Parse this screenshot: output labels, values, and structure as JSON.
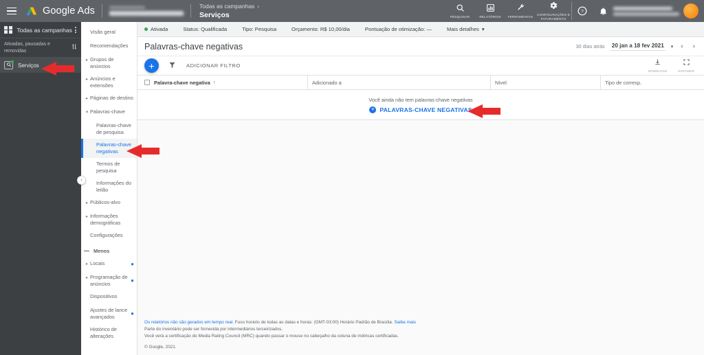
{
  "colors": {
    "accent_blue": "#1a73e8",
    "topbar_gray": "#5f6368",
    "sidebar_dark": "#3c4043",
    "status_green": "#34a853",
    "annotation_red": "#e62c2b"
  },
  "topbar": {
    "menu_icon": "hamburger-icon",
    "product_name": "Google Ads",
    "breadcrumb_parent": "Todas as campanhas",
    "breadcrumb_current": "Serviços",
    "tools": [
      {
        "icon": "search-icon",
        "glyph": "⌕",
        "label": "Pesquisar"
      },
      {
        "icon": "reports-bar-chart-icon",
        "glyph": "ὌA",
        "label": "Relatórios"
      },
      {
        "icon": "wrench-tools-icon",
        "glyph": "ὒ7",
        "label": "Ferramentas"
      },
      {
        "icon": "gear-settings-icon",
        "glyph": "⚙",
        "label": "Configurações e faturamento"
      }
    ],
    "help_icon": "help-circle-icon",
    "notifications_icon": "bell-icon",
    "avatar": "user-avatar"
  },
  "campaign_sidebar": {
    "header": "Todas as campanhas",
    "header_icon": "grid-apps-icon",
    "overflow_icon": "kebab-menu-icon",
    "filter_label": "Ativadas, pausadas e removidas",
    "sort_icon": "sort-arrows-icon",
    "campaign": {
      "name": "Serviços",
      "icon": "search-campaign-icon",
      "status": "enabled"
    }
  },
  "nav_panel": {
    "items": [
      {
        "label": "Visão geral",
        "expandable": false,
        "sub": false,
        "selected": false,
        "dot": false
      },
      {
        "label": "Recomendações",
        "expandable": false,
        "sub": false,
        "selected": false,
        "dot": false
      },
      {
        "label": "Grupos de anúncios",
        "expandable": true,
        "sub": false,
        "selected": false,
        "dot": false
      },
      {
        "label": "Anúncios e extensões",
        "expandable": true,
        "sub": false,
        "selected": false,
        "dot": false
      },
      {
        "label": "Páginas de destino",
        "expandable": true,
        "sub": false,
        "selected": false,
        "dot": false
      },
      {
        "label": "Palavras-chave",
        "expandable": true,
        "expanded": true,
        "sub": false,
        "selected": false,
        "dot": false
      },
      {
        "label": "Palavras-chave de pesquisa",
        "expandable": false,
        "sub": true,
        "selected": false,
        "dot": false
      },
      {
        "label": "Palavras-chave negativas",
        "expandable": false,
        "sub": true,
        "selected": true,
        "dot": false
      },
      {
        "label": "Termos de pesquisa",
        "expandable": false,
        "sub": true,
        "selected": false,
        "dot": false
      },
      {
        "label": "Informações do leilão",
        "expandable": false,
        "sub": true,
        "selected": false,
        "dot": false
      },
      {
        "label": "Públicos-alvo",
        "expandable": true,
        "sub": false,
        "selected": false,
        "dot": false
      },
      {
        "label": "Informações demográficas",
        "expandable": true,
        "sub": false,
        "selected": false,
        "dot": false
      },
      {
        "label": "Configurações",
        "expandable": false,
        "sub": false,
        "selected": false,
        "dot": false
      }
    ],
    "less_label": "Menos",
    "more_items": [
      {
        "label": "Locais",
        "expandable": true,
        "dot": true
      },
      {
        "label": "Programação de anúncios",
        "expandable": true,
        "dot": true
      },
      {
        "label": "Dispositivos",
        "expandable": false,
        "dot": false
      },
      {
        "label": "Ajustes de lance avançados",
        "expandable": false,
        "dot": true
      },
      {
        "label": "Histórico de alterações",
        "expandable": false,
        "dot": false
      }
    ],
    "collapse_icon": "chevron-left-icon"
  },
  "status_bar": {
    "state": "Ativada",
    "status": "Status: Qualificada",
    "type": "Tipo: Pesquisa",
    "budget": "Orçamento: R$ 10,00/dia",
    "opt_score": "Pontuação de otimização: —",
    "more_details": "Mais detalhes",
    "more_details_icon": "chevron-down-icon"
  },
  "page": {
    "title": "Palavras-chave negativas",
    "date_prefix": "30 dias atrás",
    "date_range": "20 jan a 18 fev 2021",
    "date_caret_icon": "caret-down-icon",
    "prev_icon": "chevron-left-icon",
    "next_icon": "chevron-right-icon"
  },
  "toolbar": {
    "add_icon": "plus-icon",
    "filter_icon": "funnel-filter-icon",
    "add_filter_label": "ADICIONAR FILTRO",
    "download": {
      "icon": "download-icon",
      "label": "DOWNLOAD"
    },
    "expand": {
      "icon": "expand-fullscreen-icon",
      "label": "EXPANDIR"
    }
  },
  "table": {
    "select_all_icon": "checkbox-unchecked-icon",
    "columns": [
      {
        "label": "Palavra-chave negativa",
        "sorted": true,
        "sort_icon": "arrow-up-icon"
      },
      {
        "label": "Adicionado a",
        "sorted": false
      },
      {
        "label": "Nível",
        "sorted": false
      },
      {
        "label": "Tipo de corresp.",
        "sorted": false
      }
    ],
    "empty_message": "Você ainda não tem palavras-chave negativas",
    "empty_cta": "PALAVRAS-CHAVE NEGATIVAS",
    "empty_cta_icon": "plus-circle-icon"
  },
  "footer": {
    "line1_a": "Os relatórios não são gerados em tempo real.",
    "line1_b": " Fuso horário de todas as datas e horas: (GMT-03:00) Horário Padrão de Brasília. ",
    "line1_link": "Saiba mais",
    "line2": "Parte do inventário pode ser fornecida por intermediários terceirizados.",
    "line3": "Você verá a certificação do Media Rating Council (MRC) quando passar o mouse no cabeçalho da coluna de métricas certificadas.",
    "copyright": "© Google, 2021."
  },
  "annotations": [
    {
      "name": "arrow-to-campaign-servicos",
      "direction": "left"
    },
    {
      "name": "arrow-to-nav-negative-keywords",
      "direction": "left"
    },
    {
      "name": "arrow-to-empty-state-cta",
      "direction": "left"
    }
  ]
}
